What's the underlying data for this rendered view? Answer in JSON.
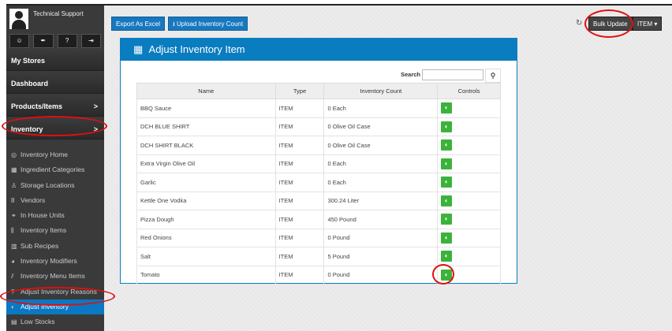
{
  "user": {
    "name": "Technical Support",
    "buttons": [
      "user-icon",
      "wrench-icon",
      "help-icon",
      "logout-icon"
    ]
  },
  "sidebar": {
    "main": [
      {
        "label": "My Stores"
      },
      {
        "label": "Dashboard"
      },
      {
        "label": "Products/Items",
        "chevron": ">"
      },
      {
        "label": "Inventory",
        "chevron": ">"
      }
    ],
    "sub": [
      {
        "label": "Inventory Home",
        "icon": "◎"
      },
      {
        "label": "Ingredient Categories",
        "icon": "▦"
      },
      {
        "label": "Storage Locations",
        "icon": "♙"
      },
      {
        "label": "Vendors",
        "icon": "8"
      },
      {
        "label": "In House Units",
        "icon": "⚭"
      },
      {
        "label": "Inventory Items",
        "icon": "⫼"
      },
      {
        "label": "Sub Recipes",
        "icon": "▥"
      },
      {
        "label": "Inventory Modifiers",
        "icon": "◕"
      },
      {
        "label": "Inventory Menu Items",
        "icon": "⫽"
      },
      {
        "label": "Adjust Inventory Reasons",
        "icon": "?"
      },
      {
        "label": "Adjust Inventory",
        "icon": "◐"
      },
      {
        "label": "Low Stocks",
        "icon": "▤"
      }
    ]
  },
  "toolbar": {
    "export": "Export As Excel",
    "upload": "Upload Inventory Count",
    "refresh": "↻",
    "bulk": "Bulk Update",
    "item": "ITEM ▾"
  },
  "panel": {
    "title": "Adjust Inventory Item",
    "search_label": "Search",
    "search_value": ""
  },
  "table": {
    "headers": [
      "Name",
      "Type",
      "Inventory Count",
      "Controls"
    ],
    "rows": [
      [
        "BBQ Sauce",
        "ITEM",
        "0 Each"
      ],
      [
        "DCH BLUE SHIRT",
        "ITEM",
        "0 Olive Oil Case"
      ],
      [
        "DCH SHIRT BLACK",
        "ITEM",
        "0 Olive Oil Case"
      ],
      [
        "Extra Virgin Olive Oil",
        "ITEM",
        "0 Each"
      ],
      [
        "Garlic",
        "ITEM",
        "0 Each"
      ],
      [
        "Kettle One Vodka",
        "ITEM",
        "300.24 Liter"
      ],
      [
        "Pizza Dough",
        "ITEM",
        "450 Pound"
      ],
      [
        "Red Onions",
        "ITEM",
        "0 Pound"
      ],
      [
        "Salt",
        "ITEM",
        "5 Pound"
      ],
      [
        "Tomato",
        "ITEM",
        "0 Pound"
      ]
    ]
  },
  "control_glyph": "◐"
}
